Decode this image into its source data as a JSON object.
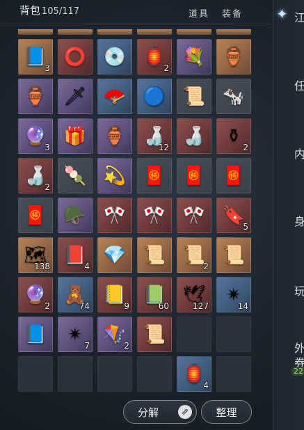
{
  "header": {
    "title": "背包",
    "capacity": "105/117",
    "tabs": [
      "道具",
      "装备"
    ]
  },
  "sidebar": {
    "labels": [
      "江",
      "任",
      "内",
      "身",
      "玩",
      "外",
      "券"
    ],
    "badge": "22"
  },
  "buttons": {
    "split": "分解",
    "sort": "整理"
  },
  "rarity_colors": {
    "orange": "#b48458",
    "red": "#8a4f4c",
    "purple": "#7a6a9a",
    "blue": "#55739a",
    "grey": "#47505a",
    "empty": "#2a323b"
  },
  "rows": [
    [
      {
        "r": "orange",
        "icon": "book-icon",
        "g": "📘",
        "q": "3"
      },
      {
        "r": "red",
        "icon": "ring-plate-icon",
        "g": "⭕",
        "q": ""
      },
      {
        "r": "blue",
        "icon": "jade-disc-icon",
        "g": "💿",
        "q": ""
      },
      {
        "r": "red",
        "icon": "lotus-lantern-icon",
        "g": "🏮",
        "q": "2"
      },
      {
        "r": "purple",
        "icon": "blue-flowers-icon",
        "g": "💐",
        "q": ""
      },
      {
        "r": "orange",
        "icon": "wine-gourd-icon",
        "g": "🏺",
        "q": ""
      }
    ],
    [
      {
        "r": "purple",
        "icon": "wine-gourd-icon",
        "g": "🏺",
        "q": ""
      },
      {
        "r": "purple",
        "icon": "spear-icon",
        "g": "🗡",
        "q": ""
      },
      {
        "r": "blue",
        "icon": "fan-disc-icon",
        "g": "🪭",
        "q": ""
      },
      {
        "r": "blue",
        "icon": "glowing-disc-icon",
        "g": "🔵",
        "q": ""
      },
      {
        "r": "grey",
        "icon": "paper-scroll-icon",
        "g": "📜",
        "q": ""
      },
      {
        "r": "grey",
        "icon": "cow-icon",
        "g": "🐄",
        "q": ""
      }
    ],
    [
      {
        "r": "purple",
        "icon": "crystal-ball-icon",
        "g": "🔮",
        "q": "3"
      },
      {
        "r": "purple",
        "icon": "gift-box-icon",
        "g": "🎁",
        "q": ""
      },
      {
        "r": "purple",
        "icon": "porcelain-jar-icon",
        "g": "🏺",
        "q": ""
      },
      {
        "r": "red",
        "icon": "white-vase-icon",
        "g": "🍶",
        "q": "12"
      },
      {
        "r": "red",
        "icon": "porcelain-vase-icon",
        "g": "🍶",
        "q": ""
      },
      {
        "r": "red",
        "icon": "ornate-vase-icon",
        "g": "⚱",
        "q": "2"
      }
    ],
    [
      {
        "r": "red",
        "icon": "round-vase-icon",
        "g": "🍶",
        "q": "2"
      },
      {
        "r": "grey",
        "icon": "sweet-bowl-icon",
        "g": "🍡",
        "q": ""
      },
      {
        "r": "purple",
        "icon": "jade-ring-icon",
        "g": "💫",
        "q": ""
      },
      {
        "r": "grey",
        "icon": "red-envelope-icon",
        "g": "🧧",
        "q": ""
      },
      {
        "r": "grey",
        "icon": "red-envelope-icon",
        "g": "🧧",
        "q": ""
      },
      {
        "r": "grey",
        "icon": "red-envelope-icon",
        "g": "🧧",
        "q": ""
      }
    ],
    [
      {
        "r": "grey",
        "icon": "red-envelope-icon",
        "g": "🧧",
        "q": ""
      },
      {
        "r": "purple",
        "icon": "armor-helmet-icon",
        "g": "🪖",
        "q": ""
      },
      {
        "r": "red",
        "icon": "banner-icon",
        "g": "🎌",
        "q": ""
      },
      {
        "r": "red",
        "icon": "banner-icon",
        "g": "🎌",
        "q": ""
      },
      {
        "r": "red",
        "icon": "banner-icon",
        "g": "🎌",
        "q": ""
      },
      {
        "r": "red",
        "icon": "talisman-icon",
        "g": "🔖",
        "q": "5"
      }
    ],
    [
      {
        "r": "orange",
        "icon": "map-scroll-icon",
        "g": "🗺",
        "q": "138"
      },
      {
        "r": "red",
        "icon": "red-book-icon",
        "g": "📕",
        "q": "4"
      },
      {
        "r": "orange",
        "icon": "blue-crystal-icon",
        "g": "💎",
        "q": ""
      },
      {
        "r": "orange",
        "icon": "scroll-icon",
        "g": "📜",
        "q": ""
      },
      {
        "r": "orange",
        "icon": "scroll-icon",
        "g": "📜",
        "q": "2"
      },
      {
        "r": "orange",
        "icon": "scroll-icon",
        "g": "📜",
        "q": ""
      }
    ],
    [
      {
        "r": "red",
        "icon": "pearl-icon",
        "g": "🔮",
        "q": "2"
      },
      {
        "r": "blue",
        "icon": "figurine-icon",
        "g": "🧸",
        "q": "74"
      },
      {
        "r": "red",
        "icon": "fabric-roll-icon",
        "g": "📒",
        "q": "9"
      },
      {
        "r": "red",
        "icon": "fabric-roll-icon",
        "g": "📗",
        "q": "60"
      },
      {
        "r": "red",
        "icon": "paper-crane-icon",
        "g": "🕊",
        "q": "127"
      },
      {
        "r": "blue",
        "icon": "golden-ring-icon",
        "g": "✴",
        "q": "14"
      }
    ],
    [
      {
        "r": "purple",
        "icon": "blue-book-icon",
        "g": "📘",
        "q": ""
      },
      {
        "r": "purple",
        "icon": "golden-ring-icon",
        "g": "✴",
        "q": "7"
      },
      {
        "r": "purple",
        "icon": "kite-icon",
        "g": "🪁",
        "q": "2"
      },
      {
        "r": "red",
        "icon": "open-scroll-icon",
        "g": "📜",
        "q": ""
      },
      {
        "r": "empty",
        "icon": "",
        "g": "",
        "q": ""
      },
      {
        "r": "empty",
        "icon": "",
        "g": "",
        "q": ""
      }
    ],
    [
      {
        "r": "empty",
        "icon": "",
        "g": "",
        "q": ""
      },
      {
        "r": "empty",
        "icon": "",
        "g": "",
        "q": ""
      },
      {
        "r": "empty",
        "icon": "",
        "g": "",
        "q": ""
      },
      {
        "r": "empty",
        "icon": "",
        "g": "",
        "q": ""
      },
      {
        "r": "blue",
        "icon": "yellow-lantern-icon",
        "g": "🏮",
        "q": "4"
      },
      {
        "r": "empty",
        "icon": "",
        "g": "",
        "q": ""
      }
    ]
  ]
}
